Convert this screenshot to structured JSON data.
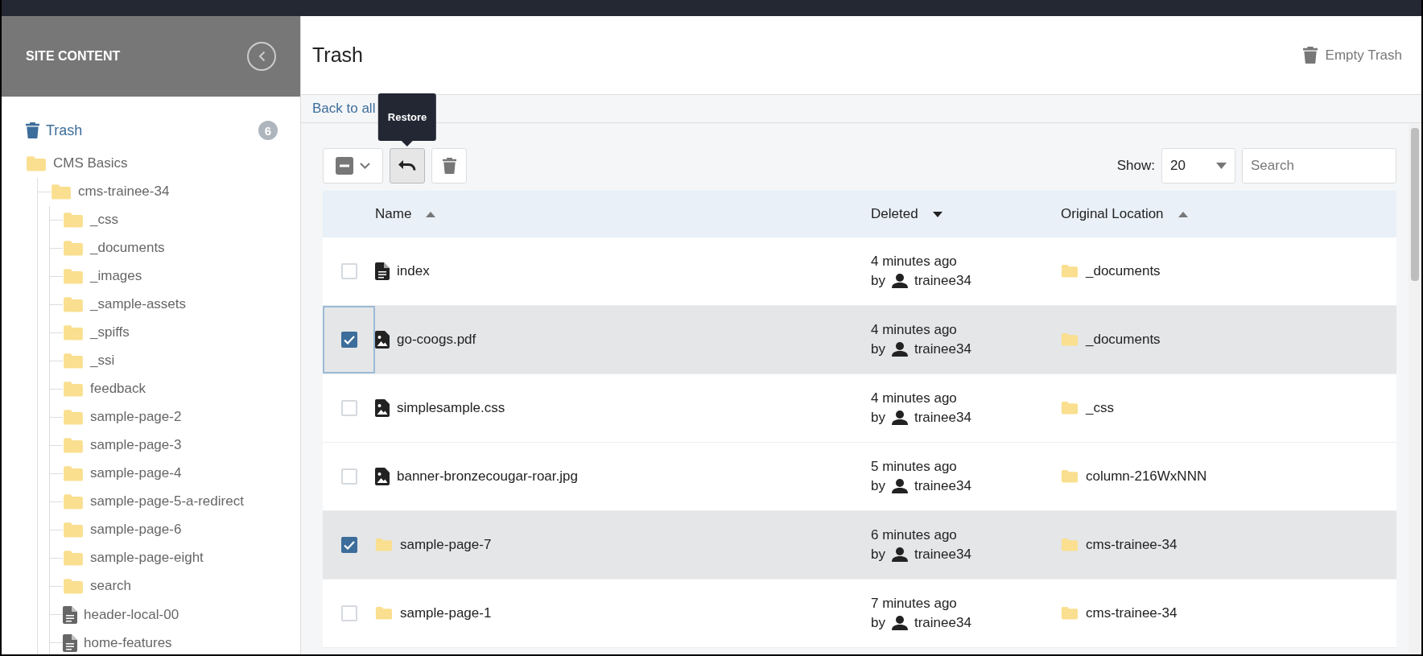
{
  "sidebar": {
    "title": "SITE CONTENT",
    "trash": {
      "label": "Trash",
      "count": "6",
      "selected": true
    },
    "tree": [
      {
        "label": "CMS Basics",
        "kind": "folder",
        "children": [
          {
            "label": "cms-trainee-34",
            "kind": "folder",
            "children": [
              {
                "label": "_css",
                "kind": "folder"
              },
              {
                "label": "_documents",
                "kind": "folder"
              },
              {
                "label": "_images",
                "kind": "folder"
              },
              {
                "label": "_sample-assets",
                "kind": "folder"
              },
              {
                "label": "_spiffs",
                "kind": "folder"
              },
              {
                "label": "_ssi",
                "kind": "folder"
              },
              {
                "label": "feedback",
                "kind": "folder"
              },
              {
                "label": "sample-page-2",
                "kind": "folder"
              },
              {
                "label": "sample-page-3",
                "kind": "folder"
              },
              {
                "label": "sample-page-4",
                "kind": "folder"
              },
              {
                "label": "sample-page-5-a-redirect",
                "kind": "folder"
              },
              {
                "label": "sample-page-6",
                "kind": "folder"
              },
              {
                "label": "sample-page-eight",
                "kind": "folder"
              },
              {
                "label": "search",
                "kind": "folder"
              },
              {
                "label": "header-local-00",
                "kind": "page"
              },
              {
                "label": "home-features",
                "kind": "page"
              }
            ]
          }
        ]
      }
    ]
  },
  "header": {
    "title": "Trash",
    "action": "Empty Trash"
  },
  "breadcrumb": {
    "link": "Back to all"
  },
  "toolbar": {
    "bulk_select": {
      "partial": true
    },
    "buttons": [
      {
        "kind": "restore",
        "hovered": true
      },
      {
        "kind": "delete",
        "hovered": false
      }
    ],
    "tooltip": "Restore",
    "show_label": "Show:",
    "page_size": "20",
    "search": {
      "placeholder": "Search"
    }
  },
  "table": {
    "columns": [
      {
        "label": "Name",
        "ascending": true,
        "active": false
      },
      {
        "label": "Deleted",
        "ascending": false,
        "active": true
      },
      {
        "label": "Original Location",
        "ascending": true,
        "active": false
      }
    ],
    "rows": [
      {
        "selected": false,
        "focused": false,
        "kind": "page",
        "name": "index",
        "deleted": "4 minutes ago",
        "by": "by",
        "user": "trainee34",
        "location": "_documents"
      },
      {
        "selected": true,
        "focused": true,
        "kind": "image",
        "name": "go-coogs.pdf",
        "deleted": "4 minutes ago",
        "by": "by",
        "user": "trainee34",
        "location": "_documents"
      },
      {
        "selected": false,
        "focused": false,
        "kind": "image",
        "name": "simplesample.css",
        "deleted": "4 minutes ago",
        "by": "by",
        "user": "trainee34",
        "location": "_css"
      },
      {
        "selected": false,
        "focused": false,
        "kind": "image",
        "name": "banner-bronzecougar-roar.jpg",
        "deleted": "5 minutes ago",
        "by": "by",
        "user": "trainee34",
        "location": "column-216WxNNN"
      },
      {
        "selected": true,
        "focused": false,
        "kind": "folder",
        "name": "sample-page-7",
        "deleted": "6 minutes ago",
        "by": "by",
        "user": "trainee34",
        "location": "cms-trainee-34"
      },
      {
        "selected": false,
        "focused": false,
        "kind": "folder",
        "name": "sample-page-1",
        "deleted": "7 minutes ago",
        "by": "by",
        "user": "trainee34",
        "location": "cms-trainee-34"
      }
    ]
  }
}
